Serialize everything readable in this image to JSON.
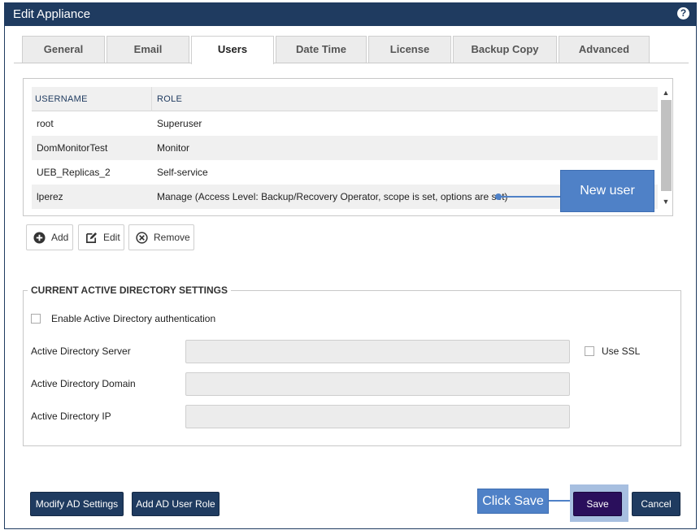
{
  "dialog": {
    "title": "Edit Appliance",
    "help_icon": "question-circle-icon"
  },
  "tabs": [
    {
      "label": "General"
    },
    {
      "label": "Email"
    },
    {
      "label": "Users",
      "active": true
    },
    {
      "label": "Date Time"
    },
    {
      "label": "License"
    },
    {
      "label": "Backup Copy"
    },
    {
      "label": "Advanced"
    }
  ],
  "users_table": {
    "columns": [
      "USERNAME",
      "ROLE"
    ],
    "rows": [
      {
        "username": "root",
        "role": "Superuser"
      },
      {
        "username": "DomMonitorTest",
        "role": "Monitor"
      },
      {
        "username": "UEB_Replicas_2",
        "role": "Self-service"
      },
      {
        "username": "lperez",
        "role": "Manage (Access Level: Backup/Recovery Operator, scope is set, options are set)"
      }
    ]
  },
  "callouts": {
    "new_user": "New user",
    "click_save": "Click Save"
  },
  "user_actions": {
    "add": "Add",
    "edit": "Edit",
    "remove": "Remove"
  },
  "ad_settings": {
    "legend": "CURRENT ACTIVE DIRECTORY SETTINGS",
    "enable_label": "Enable Active Directory authentication",
    "server_label": "Active Directory Server",
    "use_ssl_label": "Use SSL",
    "domain_label": "Active Directory Domain",
    "ip_label": "Active Directory IP",
    "server_value": "",
    "domain_value": "",
    "ip_value": ""
  },
  "footer": {
    "modify_ad": "Modify AD Settings",
    "add_ad_role": "Add AD User Role",
    "save": "Save",
    "cancel": "Cancel"
  },
  "colors": {
    "header": "#1f3b60",
    "callout": "#4f81c7",
    "save": "#2a0f5c"
  }
}
